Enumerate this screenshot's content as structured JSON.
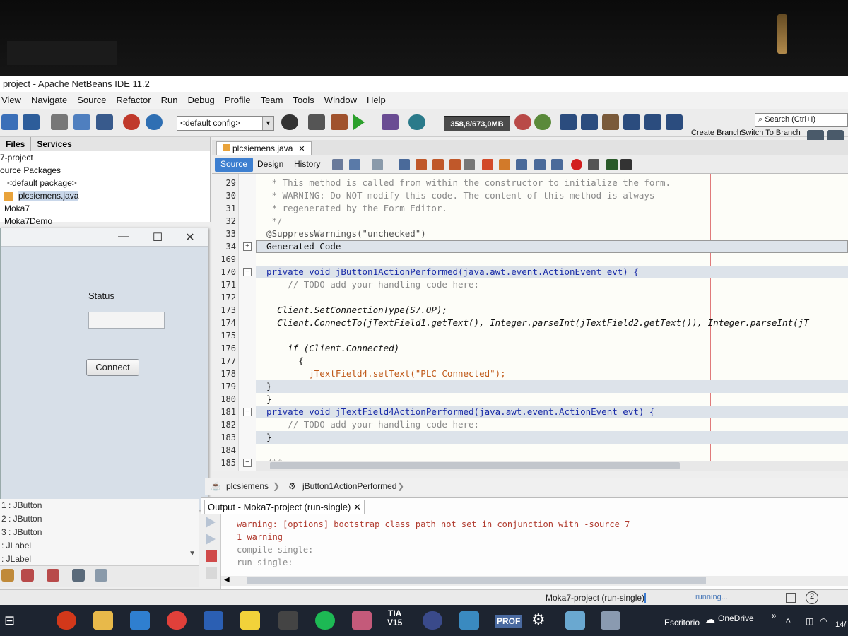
{
  "window": {
    "title": "project - Apache NetBeans IDE 11.2"
  },
  "menu": [
    "View",
    "Navigate",
    "Source",
    "Refactor",
    "Run",
    "Debug",
    "Profile",
    "Team",
    "Tools",
    "Window",
    "Help"
  ],
  "toolbar": {
    "config": "<default config>",
    "memory": "358,8/673,0MB",
    "search_placeholder": "Search (Ctrl+I)",
    "create_branch": "Create Branch",
    "switch_branch": "Switch To Branch"
  },
  "left_panel": {
    "tabs": [
      "Files",
      "Services"
    ],
    "tree": [
      "7-project",
      "ource Packages",
      "<default package>",
      "plcsiemens.java",
      "Moka7",
      "Moka7Demo"
    ]
  },
  "jframe": {
    "status_label": "Status",
    "status_value": "",
    "connect_button": "Connect",
    "min": "—",
    "max": "☐",
    "close": "✕"
  },
  "components": [
    "1 : JButton",
    "2 : JButton",
    "3 : JButton",
    ": JLabel",
    ": JLabel"
  ],
  "editor": {
    "file_tab": "plcsiemens.java",
    "views": [
      "Source",
      "Design",
      "History"
    ],
    "lines": [
      {
        "n": "29",
        "code": "   * This method is called from within the constructor to initialize the form."
      },
      {
        "n": "30",
        "code": "   * WARNING: Do NOT modify this code. The content of this method is always"
      },
      {
        "n": "31",
        "code": "   * regenerated by the Form Editor."
      },
      {
        "n": "32",
        "code": "   */"
      },
      {
        "n": "33",
        "code": "  @SuppressWarnings(\"unchecked\")"
      },
      {
        "n": "34",
        "code": "  Generated Code"
      },
      {
        "n": "169",
        "code": ""
      },
      {
        "n": "170",
        "code": "  private void jButton1ActionPerformed(java.awt.event.ActionEvent evt) {"
      },
      {
        "n": "171",
        "code": "      // TODO add your handling code here:"
      },
      {
        "n": "172",
        "code": ""
      },
      {
        "n": "173",
        "code": "    Client.SetConnectionType(S7.OP);"
      },
      {
        "n": "174",
        "code": "    Client.ConnectTo(jTextField1.getText(), Integer.parseInt(jTextField2.getText()), Integer.parseInt(jT"
      },
      {
        "n": "175",
        "code": ""
      },
      {
        "n": "176",
        "code": "      if (Client.Connected)"
      },
      {
        "n": "177",
        "code": "        {"
      },
      {
        "n": "178",
        "code": "          jTextField4.setText(\"PLC Connected\");"
      },
      {
        "n": "179",
        "code": "  }"
      },
      {
        "n": "180",
        "code": "  }"
      },
      {
        "n": "181",
        "code": "  private void jTextField4ActionPerformed(java.awt.event.ActionEvent evt) {"
      },
      {
        "n": "182",
        "code": "      // TODO add your handling code here:"
      },
      {
        "n": "183",
        "code": "  }"
      },
      {
        "n": "184",
        "code": ""
      },
      {
        "n": "185",
        "code": "  /**"
      }
    ]
  },
  "breadcrumbs": [
    "plcsiemens",
    "jButton1ActionPerformed"
  ],
  "output": {
    "tab": "Output - Moka7-project (run-single)",
    "lines": [
      {
        "text": "warning: [options] bootstrap class path not set in conjunction with -source 7",
        "color": "#b03a2e"
      },
      {
        "text": "1 warning",
        "color": "#b03a2e"
      },
      {
        "text": "compile-single:",
        "color": "#8c8c8c"
      },
      {
        "text": "run-single:",
        "color": "#8c8c8c"
      }
    ]
  },
  "status": {
    "task": "Moka7-project (run-single)",
    "progress": "running...",
    "badge": "2"
  },
  "taskbar": {
    "tia": "TIA\nV15",
    "prof": "PROF",
    "escritorio": "Escritorio",
    "onedrive": "OneDrive",
    "date": "14/"
  }
}
